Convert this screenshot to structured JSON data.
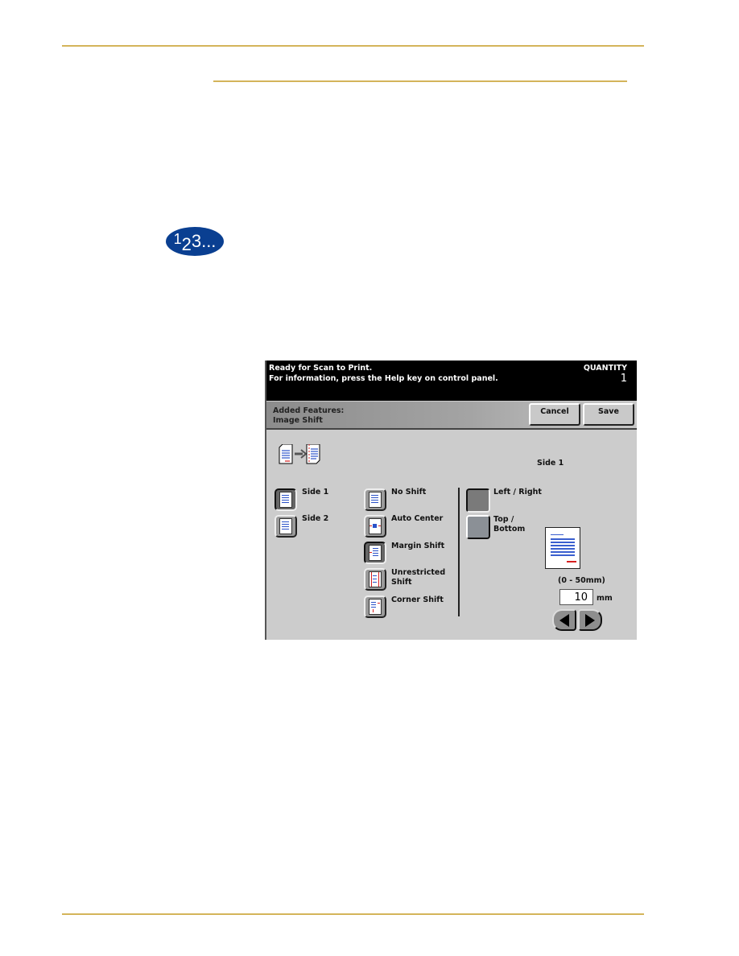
{
  "document": {
    "steps_badge": {
      "main": "1",
      "sub": "2",
      "rest": "3..."
    },
    "rule_color": "#d4b45a"
  },
  "screen": {
    "message_line_1": "Ready for Scan to Print.",
    "message_line_2": "For information, press the Help key on control panel.",
    "quantity_label": "QUANTITY",
    "quantity_value": "1",
    "title_line_1": "Added Features:",
    "title_line_2": "Image Shift",
    "cancel_label": "Cancel",
    "save_label": "Save",
    "side_indicator": "Side 1",
    "sides": [
      {
        "label": "Side 1",
        "selected": true
      },
      {
        "label": "Side 2",
        "selected": false
      }
    ],
    "shift_options": [
      {
        "label": "No Shift",
        "selected": false
      },
      {
        "label": "Auto Center",
        "selected": false
      },
      {
        "label": "Margin Shift",
        "selected": true
      },
      {
        "label": "Unrestricted Shift",
        "selected": false
      },
      {
        "label": "Corner Shift",
        "selected": false
      }
    ],
    "direction_options": [
      {
        "label": "Left / Right",
        "selected": true
      },
      {
        "label": "Top / Bottom",
        "selected": false
      }
    ],
    "range_label": "(0 - 50mm)",
    "shift_value": "10",
    "unit_label": "mm"
  }
}
